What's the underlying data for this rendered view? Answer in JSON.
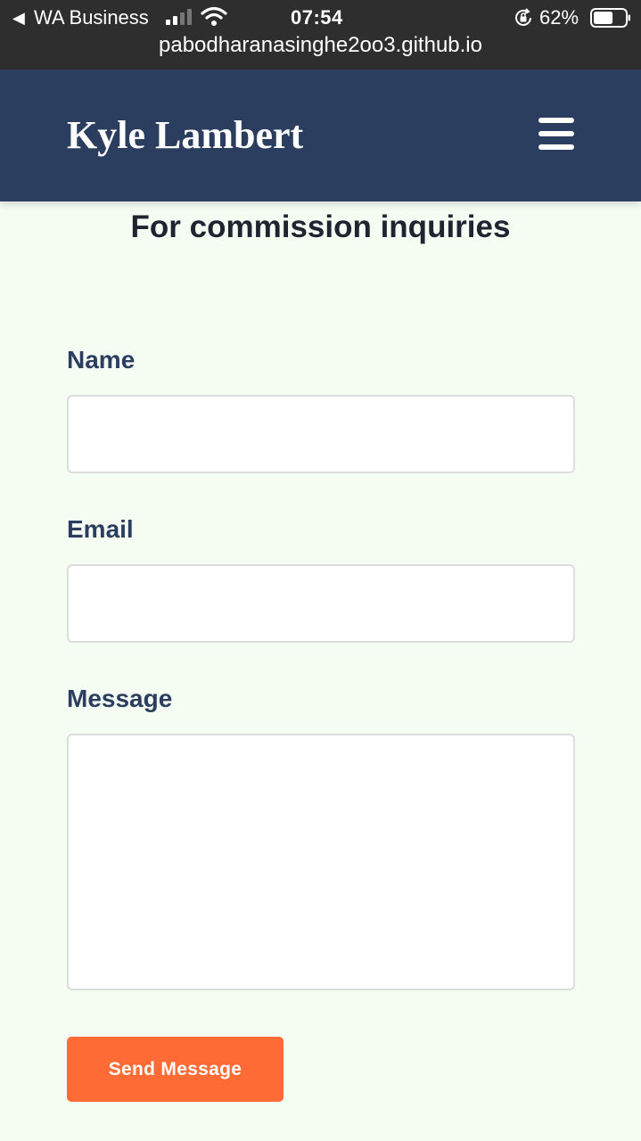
{
  "status_bar": {
    "back_glyph": "◀",
    "carrier": "WA Business",
    "time": "07:54",
    "battery_percent": "62%",
    "battery_level": 0.62,
    "url": "pabodharanasinghe2oo3.github.io",
    "icons": [
      "back-arrow-icon",
      "cellular-signal-icon",
      "wifi-icon",
      "orientation-lock-icon",
      "battery-icon"
    ]
  },
  "navbar": {
    "brand": "Kyle Lambert",
    "menu_icon": "hamburger-menu-icon"
  },
  "page": {
    "heading": "For commission inquiries"
  },
  "form": {
    "name_label": "Name",
    "name_value": "",
    "email_label": "Email",
    "email_value": "",
    "message_label": "Message",
    "message_value": "",
    "submit_label": "Send Message"
  },
  "colors": {
    "status_bar_bg": "#2e2e2e",
    "navbar_bg": "#2b3e5f",
    "page_bg": "#f5fdf3",
    "label_color": "#2b3e5f",
    "button_bg": "#ff6b35",
    "button_text": "#ffffff"
  }
}
